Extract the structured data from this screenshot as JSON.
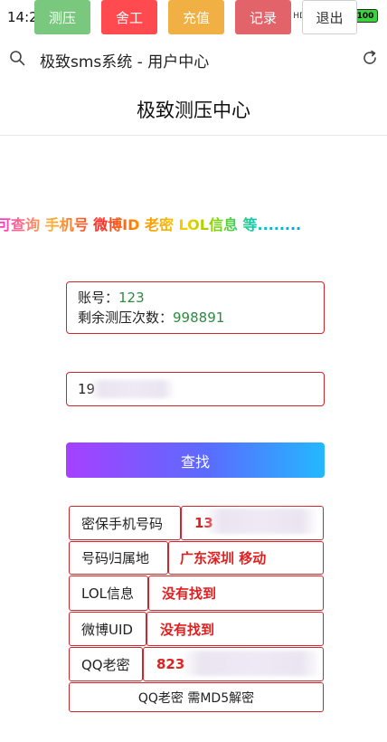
{
  "status_bar": {
    "time": "14:23",
    "dots": "··",
    "network": "HD",
    "battery": "100"
  },
  "browser": {
    "title": "极致sms系统 - 用户中心",
    "search_icon": "search-icon",
    "refresh_icon": "refresh-icon"
  },
  "page": {
    "title": "极致测压中心"
  },
  "nav": {
    "buttons": [
      {
        "label": "测压",
        "color": "#79c87e"
      },
      {
        "label": "舍工",
        "color": "#ff4a4f"
      },
      {
        "label": "充值",
        "color": "#f0b043"
      },
      {
        "label": "记录",
        "color": "#e2646a"
      },
      {
        "label": "退出",
        "color": "#ffffff"
      }
    ]
  },
  "marquee": {
    "text": "可查询 手机号 微博ID 老密 LOL信息 等........"
  },
  "account": {
    "account_label": "账号：",
    "account_value": "123",
    "remaining_label": "剩余测压次数：",
    "remaining_value": "998891"
  },
  "query": {
    "phone_value": "19",
    "search_label": "查找"
  },
  "results": {
    "rows": [
      {
        "key": "密保手机号码",
        "value": "13"
      },
      {
        "key": "号码归属地",
        "value": "广东深圳 移动"
      },
      {
        "key": "LOL信息",
        "value": "没有找到"
      },
      {
        "key": "微博UID",
        "value": "没有找到"
      },
      {
        "key": "QQ老密",
        "value": "823"
      }
    ],
    "footer": "QQ老密 需MD5解密"
  },
  "colors": {
    "accent_red": "#d0252a",
    "value_green": "#2e8b3e",
    "result_red": "#e02020",
    "button_gradient": [
      "#a640ff",
      "#23b8ff"
    ]
  }
}
